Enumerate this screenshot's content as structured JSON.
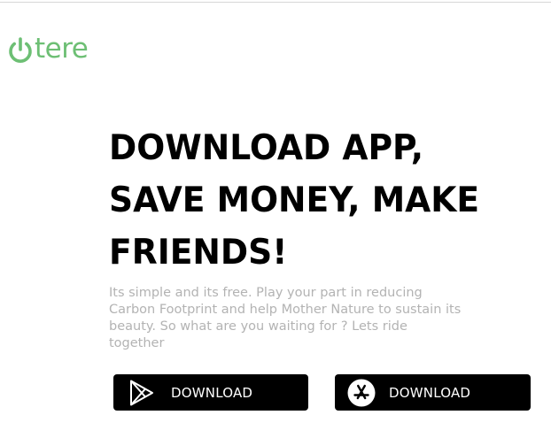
{
  "brand": {
    "name": "tere",
    "color": "#6dbf74",
    "icon": "power-icon"
  },
  "hero": {
    "headline_lines": [
      "DOWNLOAD APP,",
      "SAVE MONEY, MAKE",
      "FRIENDS!"
    ],
    "description": "Its simple and its free. Play your part in reducing Carbon Footprint and help Mother Nature to sustain its beauty. So what are you waiting for ? Lets ride together"
  },
  "downloads": {
    "google_play": {
      "label": "DOWNLOAD",
      "icon": "google-play-icon"
    },
    "app_store": {
      "label": "DOWNLOAD",
      "icon": "app-store-icon"
    }
  }
}
